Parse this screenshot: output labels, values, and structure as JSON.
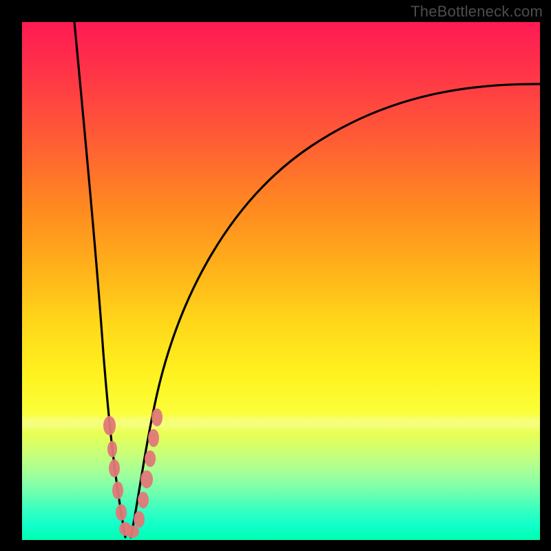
{
  "watermark": "TheBottleneck.com",
  "colors": {
    "bead": "#e07878",
    "curve": "#000000",
    "frame_bg_top": "#ff1a53",
    "frame_bg_bottom": "#00ffb2",
    "page_bg": "#000000"
  },
  "chart_data": {
    "type": "line",
    "title": "",
    "subtitle": "",
    "xlabel": "",
    "ylabel": "",
    "xlim": [
      0,
      100
    ],
    "ylim": [
      0,
      100
    ],
    "grid": false,
    "legend": false,
    "note": "Axes are implicit (no tick labels in the source). x is horizontal position 0..100 left→right; y is 0 at bottom, 100 at top. Values are read off the rendered geometry.",
    "series": [
      {
        "name": "left-curve",
        "x": [
          10.0,
          12.0,
          14.0,
          15.5,
          17.0,
          18.0,
          19.0,
          20.0
        ],
        "y": [
          100.0,
          77.0,
          53.0,
          36.0,
          20.0,
          10.0,
          3.0,
          0.0
        ]
      },
      {
        "name": "right-curve",
        "x": [
          21.0,
          22.5,
          24.0,
          26.0,
          30.0,
          36.0,
          44.0,
          54.0,
          66.0,
          80.0,
          92.0,
          100.0
        ],
        "y": [
          0.0,
          6.0,
          14.0,
          25.0,
          41.0,
          55.0,
          66.0,
          74.0,
          80.0,
          84.5,
          87.0,
          88.0
        ]
      }
    ],
    "markers": [
      {
        "series": "left-curve",
        "x": 17.0,
        "y": 22.0
      },
      {
        "series": "left-curve",
        "x": 17.6,
        "y": 16.0
      },
      {
        "series": "left-curve",
        "x": 18.3,
        "y": 10.0
      },
      {
        "series": "left-curve",
        "x": 19.0,
        "y": 5.0
      },
      {
        "series": "left-curve",
        "x": 19.7,
        "y": 1.8
      },
      {
        "series": "left-curve",
        "x": 20.5,
        "y": 0.4
      },
      {
        "series": "right-curve",
        "x": 21.3,
        "y": 0.8
      },
      {
        "series": "right-curve",
        "x": 22.2,
        "y": 3.0
      },
      {
        "series": "right-curve",
        "x": 23.0,
        "y": 7.0
      },
      {
        "series": "right-curve",
        "x": 23.6,
        "y": 11.5
      },
      {
        "series": "right-curve",
        "x": 24.2,
        "y": 16.0
      },
      {
        "series": "right-curve",
        "x": 25.0,
        "y": 21.0
      },
      {
        "series": "right-curve",
        "x": 25.8,
        "y": 25.5
      }
    ]
  }
}
